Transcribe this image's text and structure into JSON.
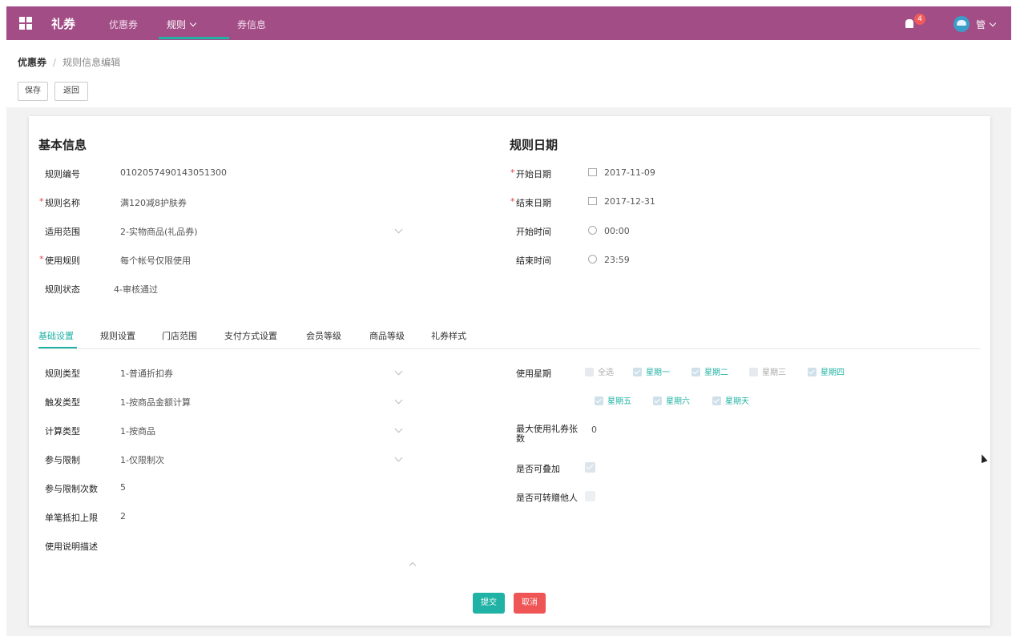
{
  "header": {
    "brand": "礼券",
    "nav": [
      "优惠券",
      "规则",
      "券信息"
    ],
    "notification_count": "4",
    "username": "管"
  },
  "breadcrumb": {
    "root": "优惠券",
    "current": "规则信息编辑"
  },
  "actions": {
    "save": "保存",
    "back": "返回"
  },
  "basic": {
    "title": "基本信息",
    "fields": [
      {
        "label": "规则编号",
        "value": "0102057490143051300"
      },
      {
        "label": "规则名称",
        "value": "满120减8护肤券"
      },
      {
        "label": "适用范围",
        "value": "2-实物商品(礼品券)"
      },
      {
        "label": "使用规则",
        "value": "每个帐号仅限使用"
      },
      {
        "label": "规则状态",
        "value": "4-审核通过"
      }
    ]
  },
  "dates": {
    "title": "规则日期",
    "fields": [
      {
        "label": "开始日期",
        "value": "2017-11-09"
      },
      {
        "label": "结束日期",
        "value": "2017-12-31"
      },
      {
        "label": "开始时间",
        "value": "00:00"
      },
      {
        "label": "结束时间",
        "value": "23:59"
      }
    ]
  },
  "tabs": [
    "基础设置",
    "规则设置",
    "门店范围",
    "支付方式设置",
    "会员等级",
    "商品等级",
    "礼券样式"
  ],
  "settings": {
    "left": [
      {
        "label": "规则类型",
        "value": "1-普通折扣券"
      },
      {
        "label": "触发类型",
        "value": "1-按商品金额计算"
      },
      {
        "label": "计算类型",
        "value": "1-按商品"
      },
      {
        "label": "参与限制",
        "value": "1-仅限制次"
      },
      {
        "label": "参与限制次数",
        "value": "5"
      },
      {
        "label": "单笔抵扣上限",
        "value": "2"
      },
      {
        "label": "使用说明描述",
        "value": ""
      }
    ],
    "weekday_label": "使用星期",
    "weekdays": [
      {
        "label": "全选",
        "checked": false
      },
      {
        "label": "星期一",
        "checked": true
      },
      {
        "label": "星期二",
        "checked": true
      },
      {
        "label": "星期三",
        "checked": false
      },
      {
        "label": "星期四",
        "checked": true
      },
      {
        "label": "星期五",
        "checked": true
      },
      {
        "label": "星期六",
        "checked": true
      },
      {
        "label": "星期天",
        "checked": true
      }
    ],
    "max_label": "最大使用礼券张数",
    "max_value": "0",
    "stackable_label": "是否可叠加",
    "stackable": true,
    "forward_label": "是否可转赠他人",
    "forward": false
  },
  "footer": {
    "confirm": "提交",
    "cancel": "取消"
  },
  "colors": {
    "header": "#a24d86",
    "accent": "#20b2a4",
    "danger": "#ef5555"
  }
}
